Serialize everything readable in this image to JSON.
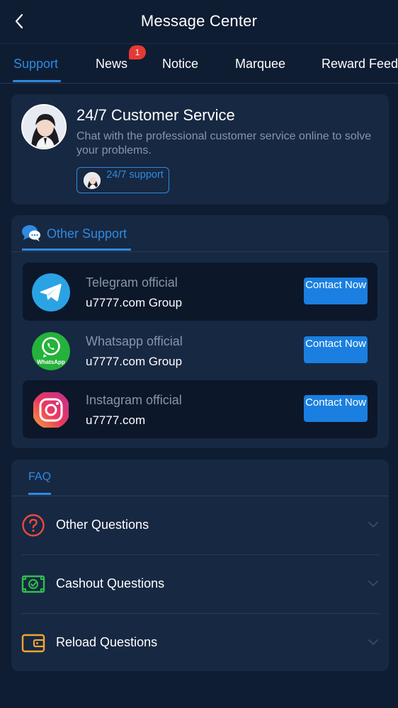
{
  "header": {
    "title": "Message Center"
  },
  "tabs": [
    {
      "label": "Support",
      "active": true
    },
    {
      "label": "News",
      "badge": "1"
    },
    {
      "label": "Notice"
    },
    {
      "label": "Marquee"
    },
    {
      "label": "Reward Feed"
    }
  ],
  "customer_service": {
    "title": "24/7 Customer Service",
    "description": "Chat with the professional customer service online to solve your problems.",
    "button_label": "24/7 support"
  },
  "other_support": {
    "title": "Other Support",
    "items": [
      {
        "name": "Telegram official",
        "group": "u7777.com Group",
        "button": "Contact Now",
        "icon": "telegram-icon"
      },
      {
        "name": "Whatsapp official",
        "group": "u7777.com Group",
        "button": "Contact Now",
        "icon": "whatsapp-icon"
      },
      {
        "name": "Instagram official",
        "group": "u7777.com",
        "button": "Contact Now",
        "icon": "instagram-icon"
      }
    ]
  },
  "faq": {
    "tab_label": "FAQ",
    "items": [
      {
        "label": "Other Questions",
        "icon": "question-icon"
      },
      {
        "label": "Cashout Questions",
        "icon": "cash-icon"
      },
      {
        "label": "Reload Questions",
        "icon": "wallet-icon"
      }
    ]
  },
  "colors": {
    "background": "#0f1d33",
    "card": "#172842",
    "accent": "#2f8ae0",
    "button": "#1a7fe0",
    "badge": "#e53935"
  }
}
